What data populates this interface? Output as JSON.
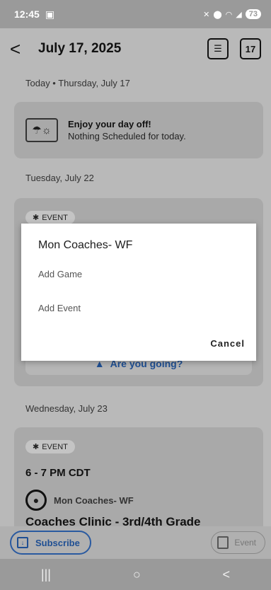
{
  "status_bar": {
    "time": "12:45",
    "battery": "73"
  },
  "app_bar": {
    "back_glyph": "<",
    "title": "July 17, 2025",
    "calendar_day": "17"
  },
  "sections": {
    "today": {
      "header": "Today • Thursday, July 17",
      "card_title": "Enjoy your day off!",
      "card_subtitle": "Nothing Scheduled for today."
    },
    "tuesday": {
      "header": "Tuesday, July 22",
      "chip": "EVENT",
      "rsvp": "Are you going?"
    },
    "wednesday": {
      "header": "Wednesday, July 23",
      "chip": "EVENT",
      "time": "6 - 7 PM CDT",
      "club": "Mon Coaches- WF",
      "title": "Coaches Clinic - 3rd/4th Grade"
    }
  },
  "bottom_bar": {
    "subscribe_label": "Subscribe",
    "event_label": "Event"
  },
  "dialog": {
    "title": "Mon Coaches- WF",
    "options": [
      "Add Game",
      "Add Event"
    ],
    "cancel_label": "Cancel"
  },
  "nav": {
    "recents": "|||",
    "home": "○",
    "back": "<"
  },
  "colors": {
    "accent": "#1f4f93",
    "scrim_gray": "#b9b9b9"
  }
}
